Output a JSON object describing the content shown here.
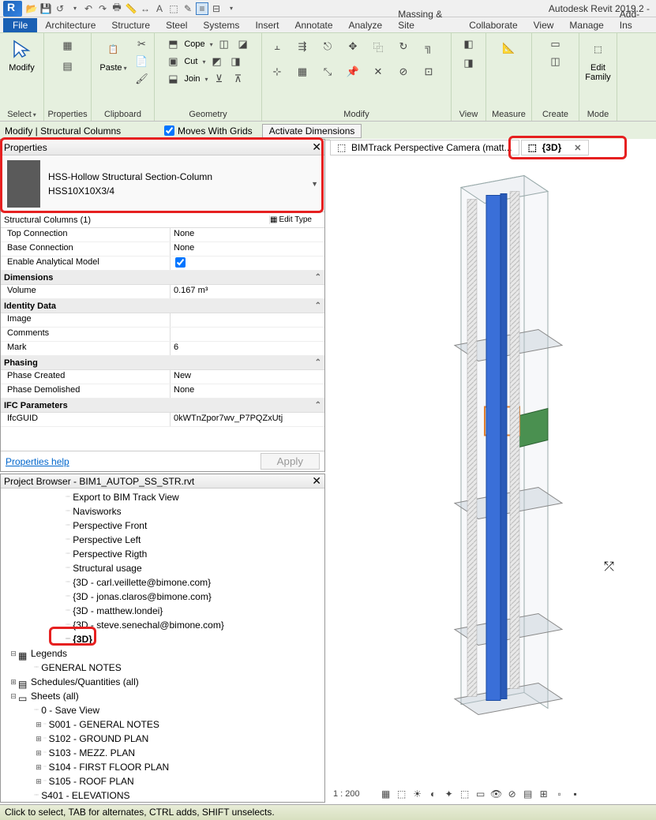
{
  "app": {
    "title": "Autodesk Revit 2019.2 -"
  },
  "menutabs": [
    "File",
    "Architecture",
    "Structure",
    "Steel",
    "Systems",
    "Insert",
    "Annotate",
    "Analyze",
    "Massing & Site",
    "Collaborate",
    "View",
    "Manage",
    "Add-Ins"
  ],
  "ribbon": {
    "select_label": "Select",
    "select_btn": "Modify",
    "props_btn": "Properties",
    "clipboard_label": "Clipboard",
    "paste_btn": "Paste",
    "geometry_label": "Geometry",
    "cope_btn": "Cope",
    "cut_btn": "Cut",
    "join_btn": "Join",
    "modify_label": "Modify",
    "view_label": "View",
    "measure_label": "Measure",
    "create_label": "Create",
    "mode_label": "Mode",
    "edit_family": "Edit\nFamily"
  },
  "optsbar": {
    "context": "Modify | Structural Columns",
    "moves": "Moves With Grids",
    "activate": "Activate Dimensions"
  },
  "viewtabs": {
    "tab1": "BIMTrack Perspective Camera (matt...",
    "tab2": "{3D}"
  },
  "props": {
    "title": "Properties",
    "type_name": "HSS-Hollow Structural Section-Column",
    "type_size": "HSS10X10X3/4",
    "selector": "Structural Columns (1)",
    "edit_type": "Edit Type",
    "rows": {
      "top_conn_n": "Top Connection",
      "top_conn_v": "None",
      "base_conn_n": "Base Connection",
      "base_conn_v": "None",
      "enable_n": "Enable Analytical Model",
      "dim_grp": "Dimensions",
      "vol_n": "Volume",
      "vol_v": "0.167 m³",
      "id_grp": "Identity Data",
      "img_n": "Image",
      "img_v": "",
      "comm_n": "Comments",
      "comm_v": "",
      "mark_n": "Mark",
      "mark_v": "6",
      "phase_grp": "Phasing",
      "created_n": "Phase Created",
      "created_v": "New",
      "demo_n": "Phase Demolished",
      "demo_v": "None",
      "ifc_grp": "IFC Parameters",
      "guid_n": "IfcGUID",
      "guid_v": "0kWTnZpor7wv_P7PQZxUtj"
    },
    "help": "Properties help",
    "apply": "Apply"
  },
  "browser": {
    "title": "Project Browser - BIM1_AUTOP_SS_STR.rvt",
    "items": [
      "Export to BIM Track View",
      "Navisworks",
      "Perspective Front",
      "Perspective Left",
      "Perspective Rigth",
      "Structural usage",
      "{3D - carl.veillette@bimone.com}",
      "{3D - jonas.claros@bimone.com}",
      "{3D - matthew.londei}",
      "{3D - steve.senechal@bimone.com}",
      "{3D}"
    ],
    "legends": "Legends",
    "legends_child": "GENERAL NOTES",
    "schedules": "Schedules/Quantities (all)",
    "sheets": "Sheets (all)",
    "sheet_items": [
      "0 - Save View",
      "S001 - GENERAL NOTES",
      "S102 - GROUND PLAN",
      "S103 - MEZZ. PLAN",
      "S104 - FIRST FLOOR PLAN",
      "S105 - ROOF PLAN",
      "S401 - ELEVATIONS"
    ]
  },
  "view": {
    "scale": "1 : 200"
  },
  "status": "Click to select, TAB for alternates, CTRL adds, SHIFT unselects."
}
